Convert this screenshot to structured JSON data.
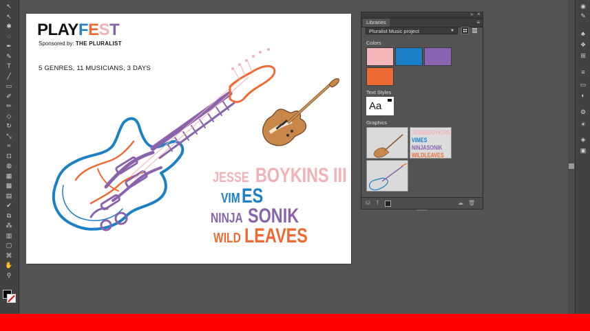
{
  "artboard": {
    "logo_play": "PLAY",
    "logo_fest_f": "F",
    "logo_fest_e": "E",
    "logo_fest_s": "S",
    "logo_fest_t": "T",
    "sponsor_prefix": "Sponsored by:",
    "sponsor_name": "THE PLURALIST",
    "genres_line": "5 GENRES, 11 MUSICIANS, 3 DAYS",
    "lineup": [
      {
        "first": "JESSE",
        "last": "BOYKINS III"
      },
      {
        "first": "VIM",
        "last": "ES"
      },
      {
        "first": "NINJA",
        "last": "SONIK"
      },
      {
        "first": "WILD",
        "last": "LEAVES"
      }
    ]
  },
  "libraries_panel": {
    "tab_label": "Libraries",
    "library_name": "Pluralist Music project",
    "colors_label": "Colors",
    "colors": [
      "#f4b6b9",
      "#1a7fc7",
      "#8a64b2",
      "#ee6a33"
    ],
    "text_styles_label": "Text Styles",
    "text_style_sample": "Aa",
    "graphics_label": "Graphics",
    "graphic_text_lines": [
      "JESSEBOYKINS III",
      "VIMES",
      "NINJASONIK",
      "WILDLEAVES"
    ],
    "footer_icons": [
      "add-content-icon",
      "text-icon",
      "stroke-icon",
      "cloud-sync-icon",
      "trash-icon"
    ]
  },
  "brand_colors": {
    "blue": "#1c80c4",
    "orange": "#ee6a33",
    "pink": "#f2b1b7",
    "purple": "#8a63ad"
  },
  "left_tools": [
    "selection-tool-icon",
    "direct-selection-tool-icon",
    "magic-wand-tool-icon",
    "lasso-tool-icon",
    "pen-tool-icon",
    "curvature-tool-icon",
    "type-tool-icon",
    "line-tool-icon",
    "rectangle-tool-icon",
    "paintbrush-tool-icon",
    "pencil-tool-icon",
    "eraser-tool-icon",
    "rotate-tool-icon",
    "scale-tool-icon",
    "warp-tool-icon",
    "free-transform-tool-icon",
    "shape-builder-tool-icon",
    "perspective-grid-tool-icon",
    "mesh-tool-icon",
    "gradient-tool-icon",
    "eyedropper-tool-icon",
    "blend-tool-icon",
    "symbol-sprayer-tool-icon",
    "column-graph-tool-icon",
    "artboard-tool-icon",
    "slice-tool-icon",
    "hand-tool-icon",
    "zoom-tool-icon"
  ],
  "right_dock_icons": [
    "appearance-icon",
    "brushes-icon",
    "symbols-icon",
    "graphic-styles-icon",
    "align-icon",
    "stroke-icon",
    "gradient-icon",
    "transparency-icon",
    "color-icon",
    "color-guide-icon",
    "layers-icon",
    "artboards-icon"
  ]
}
